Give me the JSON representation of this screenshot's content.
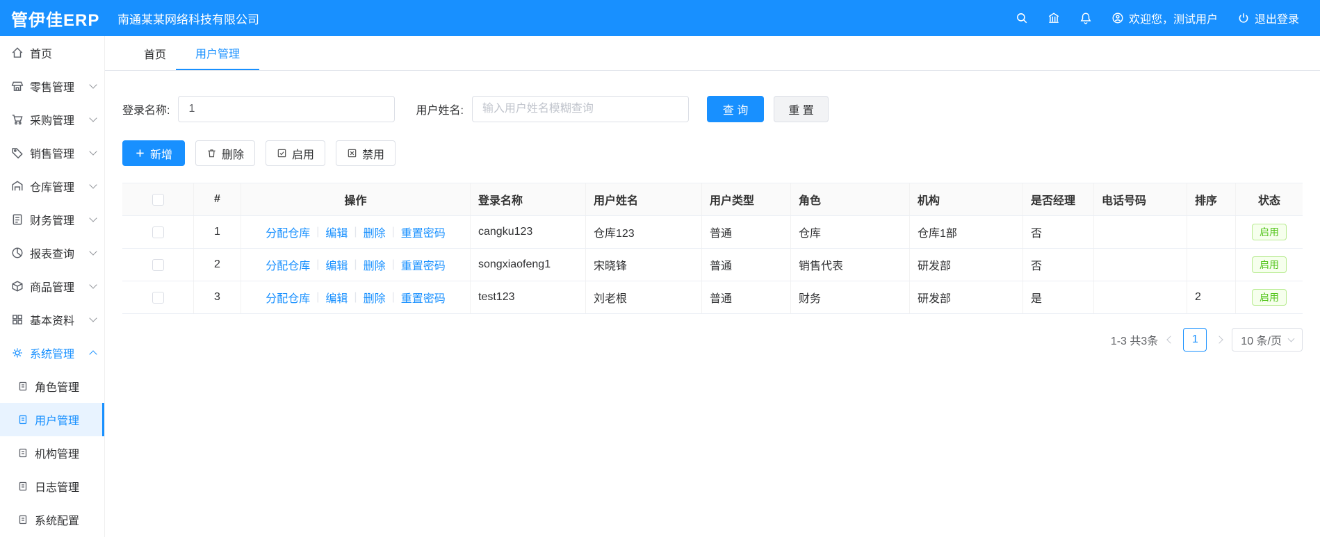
{
  "topbar": {
    "logo": "管伊佳ERP",
    "company": "南通某某网络科技有限公司",
    "welcome": "欢迎您，测试用户",
    "logout": "退出登录"
  },
  "sidebar": {
    "items": [
      {
        "label": "首页"
      },
      {
        "label": "零售管理"
      },
      {
        "label": "采购管理"
      },
      {
        "label": "销售管理"
      },
      {
        "label": "仓库管理"
      },
      {
        "label": "财务管理"
      },
      {
        "label": "报表查询"
      },
      {
        "label": "商品管理"
      },
      {
        "label": "基本资料"
      },
      {
        "label": "系统管理"
      }
    ],
    "subitems": [
      {
        "label": "角色管理"
      },
      {
        "label": "用户管理"
      },
      {
        "label": "机构管理"
      },
      {
        "label": "日志管理"
      },
      {
        "label": "系统配置"
      }
    ]
  },
  "tabs": {
    "home": "首页",
    "current": "用户管理"
  },
  "filters": {
    "login_label": "登录名称:",
    "login_value": "1",
    "name_label": "用户姓名:",
    "name_placeholder": "输入用户姓名模糊查询",
    "search_button": "查 询",
    "reset_button": "重 置"
  },
  "toolbar": {
    "add": "新增",
    "remove": "删除",
    "enable": "启用",
    "disable": "禁用"
  },
  "table": {
    "headers": [
      "#",
      "操作",
      "登录名称",
      "用户姓名",
      "用户类型",
      "角色",
      "机构",
      "是否经理",
      "电话号码",
      "排序",
      "状态"
    ],
    "ops": {
      "assign": "分配仓库",
      "edit": "编辑",
      "del": "删除",
      "reset": "重置密码"
    },
    "rows": [
      {
        "index": "1",
        "login": "cangku123",
        "name": "仓库123",
        "type": "普通",
        "role": "仓库",
        "org": "仓库1部",
        "manager": "否",
        "phone": "",
        "sort": "",
        "status": "启用"
      },
      {
        "index": "2",
        "login": "songxiaofeng1",
        "name": "宋晓锋",
        "type": "普通",
        "role": "销售代表",
        "org": "研发部",
        "manager": "否",
        "phone": "",
        "sort": "",
        "status": "启用"
      },
      {
        "index": "3",
        "login": "test123",
        "name": "刘老根",
        "type": "普通",
        "role": "财务",
        "org": "研发部",
        "manager": "是",
        "phone": "",
        "sort": "2",
        "status": "启用"
      }
    ]
  },
  "pagination": {
    "total": "1-3 共3条",
    "page": "1",
    "page_size": "10 条/页"
  },
  "colors": {
    "primary": "#1890ff",
    "success": "#52c41a"
  }
}
